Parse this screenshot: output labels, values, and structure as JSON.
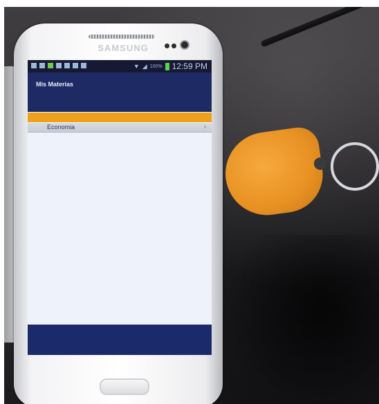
{
  "phone": {
    "brand": "SAMSUNG"
  },
  "status_bar": {
    "battery_percent": "100%",
    "time": "12:59 PM"
  },
  "app": {
    "title": "Mis Materias",
    "accent_color": "#f0a11b",
    "header_color": "#1d2a64",
    "items": [
      {
        "label": "Economia"
      }
    ]
  }
}
